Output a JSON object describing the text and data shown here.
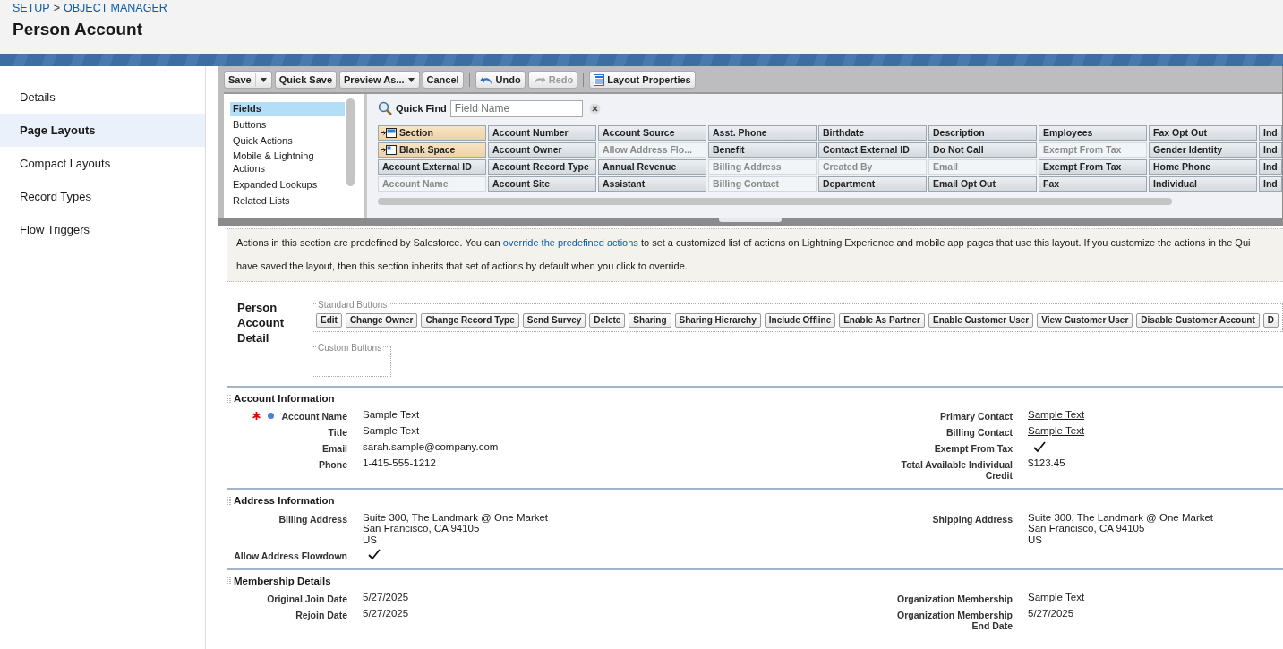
{
  "breadcrumb": {
    "items": [
      "SETUP",
      "OBJECT MANAGER"
    ],
    "separator": ">"
  },
  "page_title": "Person Account",
  "sidebar": {
    "items": [
      {
        "label": "Details",
        "selected": false
      },
      {
        "label": "Page Layouts",
        "selected": true
      },
      {
        "label": "Compact Layouts",
        "selected": false
      },
      {
        "label": "Record Types",
        "selected": false
      },
      {
        "label": "Flow Triggers",
        "selected": false
      }
    ]
  },
  "toolbar": {
    "groups": [
      [
        {
          "label": "Save",
          "kind": "split",
          "disabled": false
        },
        {
          "label": "Quick Save",
          "kind": "plain",
          "disabled": false
        },
        {
          "label": "Preview As...",
          "kind": "menu",
          "disabled": false
        },
        {
          "label": "Cancel",
          "kind": "plain",
          "disabled": false
        }
      ],
      [
        {
          "label": "Undo",
          "kind": "undo",
          "disabled": false
        },
        {
          "label": "Redo",
          "kind": "redo",
          "disabled": true
        }
      ],
      [
        {
          "label": "Layout Properties",
          "kind": "properties",
          "disabled": false
        }
      ]
    ]
  },
  "palette": {
    "categories": [
      {
        "label": "Fields",
        "selected": true
      },
      {
        "label": "Buttons",
        "selected": false
      },
      {
        "label": "Quick Actions",
        "selected": false
      },
      {
        "label": "Mobile & Lightning Actions",
        "selected": false
      },
      {
        "label": "Expanded Lookups",
        "selected": false
      },
      {
        "label": "Related Lists",
        "selected": false
      }
    ],
    "quick_find": {
      "label": "Quick Find",
      "placeholder": "Field Name"
    },
    "columns": [
      {
        "items": [
          {
            "label": "Section",
            "kind": "section",
            "used": false
          },
          {
            "label": "Blank Space",
            "kind": "blank",
            "used": false
          },
          {
            "label": "Account External ID",
            "kind": "field",
            "used": false
          },
          {
            "label": "Account Name",
            "kind": "field",
            "used": true
          }
        ]
      },
      {
        "items": [
          {
            "label": "Account Number",
            "kind": "field",
            "used": false
          },
          {
            "label": "Account Owner",
            "kind": "field",
            "used": false
          },
          {
            "label": "Account Record Type",
            "kind": "field",
            "used": false
          },
          {
            "label": "Account Site",
            "kind": "field",
            "used": false
          }
        ]
      },
      {
        "items": [
          {
            "label": "Account Source",
            "kind": "field",
            "used": false
          },
          {
            "label": "Allow Address Flo...",
            "kind": "field",
            "used": true
          },
          {
            "label": "Annual Revenue",
            "kind": "field",
            "used": false
          },
          {
            "label": "Assistant",
            "kind": "field",
            "used": false
          }
        ]
      },
      {
        "items": [
          {
            "label": "Asst. Phone",
            "kind": "field",
            "used": false
          },
          {
            "label": "Benefit",
            "kind": "field",
            "used": false
          },
          {
            "label": "Billing Address",
            "kind": "field",
            "used": true
          },
          {
            "label": "Billing Contact",
            "kind": "field",
            "used": true
          }
        ]
      },
      {
        "items": [
          {
            "label": "Birthdate",
            "kind": "field",
            "used": false
          },
          {
            "label": "Contact External ID",
            "kind": "field",
            "used": false
          },
          {
            "label": "Created By",
            "kind": "field",
            "used": true
          },
          {
            "label": "Department",
            "kind": "field",
            "used": false
          }
        ]
      },
      {
        "items": [
          {
            "label": "Description",
            "kind": "field",
            "used": false
          },
          {
            "label": "Do Not Call",
            "kind": "field",
            "used": false
          },
          {
            "label": "Email",
            "kind": "field",
            "used": true
          },
          {
            "label": "Email Opt Out",
            "kind": "field",
            "used": false
          }
        ]
      },
      {
        "items": [
          {
            "label": "Employees",
            "kind": "field",
            "used": false
          },
          {
            "label": "Exempt From Tax",
            "kind": "field",
            "used": true
          },
          {
            "label": "Exempt From Tax",
            "kind": "field",
            "used": false
          },
          {
            "label": "Fax",
            "kind": "field",
            "used": false
          }
        ]
      },
      {
        "items": [
          {
            "label": "Fax Opt Out",
            "kind": "field",
            "used": false
          },
          {
            "label": "Gender Identity",
            "kind": "field",
            "used": false
          },
          {
            "label": "Home Phone",
            "kind": "field",
            "used": false
          },
          {
            "label": "Individual",
            "kind": "field",
            "used": false
          }
        ]
      },
      {
        "items": [
          {
            "label": "Ind",
            "kind": "field",
            "used": false
          },
          {
            "label": "Ind",
            "kind": "field",
            "used": false
          },
          {
            "label": "Ind",
            "kind": "field",
            "used": false
          },
          {
            "label": "Ind",
            "kind": "field",
            "used": false
          }
        ]
      }
    ]
  },
  "actions_note": {
    "before": "Actions in this section are predefined by Salesforce. You can ",
    "link": "override the predefined actions",
    "after": " to set a customized list of actions on Lightning Experience and mobile app pages that use this layout. If you customize the actions in the Qui",
    "line_2": "have saved the layout, then this section inherits that set of actions by default when you click to override."
  },
  "detail": {
    "title": "Person Account Detail",
    "standard_label": "Standard Buttons",
    "custom_label": "Custom Buttons",
    "standard_buttons": [
      "Edit",
      "Change Owner",
      "Change Record Type",
      "Send Survey",
      "Delete",
      "Sharing",
      "Sharing Hierarchy",
      "Include Offline",
      "Enable As Partner",
      "Enable Customer User",
      "View Customer User",
      "Disable Customer Account",
      "D"
    ]
  },
  "sections": [
    {
      "title": "Account Information",
      "left": [
        {
          "label": "Account Name",
          "kind": "text",
          "value": "Sample Text",
          "required": true
        },
        {
          "label": "Title",
          "kind": "text",
          "value": "Sample Text",
          "required": false
        },
        {
          "label": "Email",
          "kind": "text",
          "value": "sarah.sample@company.com",
          "required": false
        },
        {
          "label": "Phone",
          "kind": "text",
          "value": "1-415-555-1212",
          "required": false
        }
      ],
      "right": [
        {
          "label": "Primary Contact",
          "kind": "link",
          "value": "Sample Text",
          "required": false
        },
        {
          "label": "Billing Contact",
          "kind": "link",
          "value": "Sample Text",
          "required": false
        },
        {
          "label": "Exempt From Tax",
          "kind": "check",
          "checked": true,
          "required": false
        },
        {
          "label": "Total Available Individual Credit",
          "kind": "text",
          "value": "$123.45",
          "required": false
        }
      ]
    },
    {
      "title": "Address Information",
      "left": [
        {
          "label": "Billing Address",
          "kind": "address",
          "lines": [
            "Suite 300, The Landmark @ One Market",
            "San Francisco, CA 94105",
            "US"
          ],
          "required": false
        },
        {
          "label": "Allow Address Flowdown",
          "kind": "check",
          "checked": true,
          "required": false
        }
      ],
      "right": [
        {
          "label": "Shipping Address",
          "kind": "address",
          "lines": [
            "Suite 300, The Landmark @ One Market",
            "San Francisco, CA 94105",
            "US"
          ],
          "required": false
        }
      ]
    },
    {
      "title": "Membership Details",
      "left": [
        {
          "label": "Original Join Date",
          "kind": "text",
          "value": "5/27/2025",
          "required": false
        },
        {
          "label": "Rejoin Date",
          "kind": "text",
          "value": "5/27/2025",
          "required": false
        }
      ],
      "right": [
        {
          "label": "Organization Membership",
          "kind": "link",
          "value": "Sample Text",
          "required": false
        },
        {
          "label": "Organization Membership End Date",
          "kind": "text",
          "value": "5/27/2025",
          "required": false
        }
      ]
    }
  ]
}
